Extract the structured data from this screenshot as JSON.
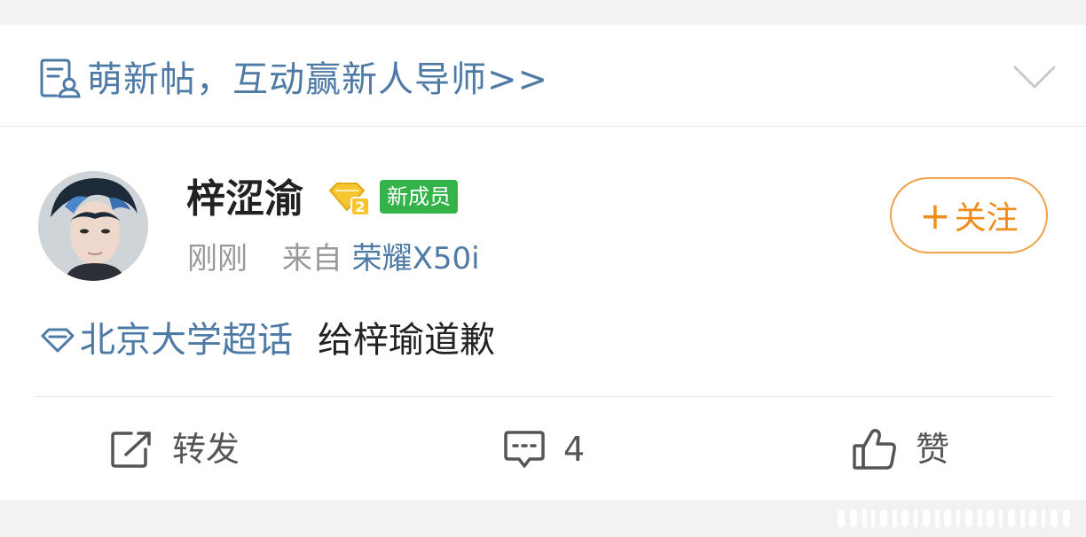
{
  "banner": {
    "text": "萌新帖，互动赢新人导师>>"
  },
  "post": {
    "username": "梓涩渝",
    "level_badge": "2",
    "member_badge": "新成员",
    "time": "刚刚",
    "source_prefix": "来自",
    "source_device": "荣耀X50i",
    "follow_label": "关注",
    "follow_plus": "+",
    "topic": "北京大学超话",
    "content": "给梓瑜道歉"
  },
  "actions": {
    "repost_label": "转发",
    "comment_count": "4",
    "like_label": "赞"
  },
  "colors": {
    "link": "#4e7aa6",
    "follow": "#f08c1a",
    "badge_green": "#35b34b"
  }
}
